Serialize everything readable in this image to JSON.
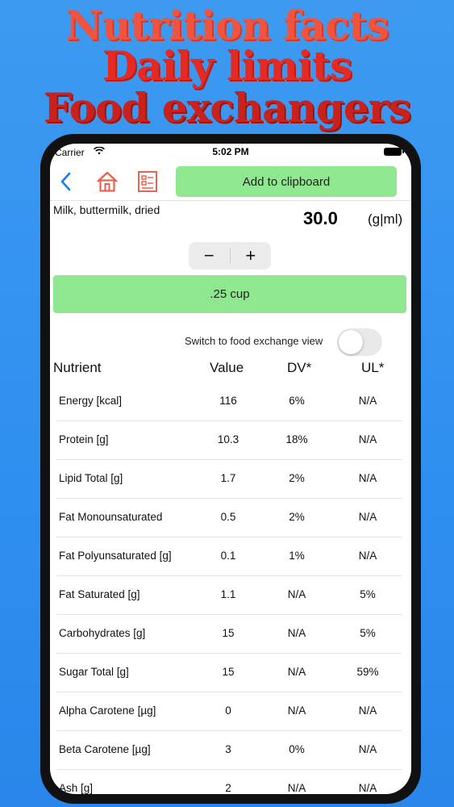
{
  "promo": {
    "line1": "Nutrition facts",
    "line2": "Daily limits",
    "line3": "Food exchangers"
  },
  "status": {
    "carrier": "Carrier",
    "time": "5:02 PM"
  },
  "toolbar": {
    "clipboard_label": "Add to clipboard"
  },
  "food": {
    "name": "Milk, buttermilk, dried",
    "amount": "30.0",
    "unit": "(g|ml)"
  },
  "stepper": {
    "minus": "−",
    "plus": "+"
  },
  "portion": {
    "label": ".25 cup"
  },
  "exchange_switch": {
    "label": "Switch to food exchange view",
    "on": false
  },
  "table": {
    "headers": {
      "nutrient": "Nutrient",
      "value": "Value",
      "dv": "DV*",
      "ul": "UL*"
    },
    "rows": [
      {
        "name": "Energy [kcal]",
        "value": "116",
        "dv": "6%",
        "ul": "N/A"
      },
      {
        "name": "Protein [g]",
        "value": "10.3",
        "dv": "18%",
        "ul": "N/A"
      },
      {
        "name": "Lipid Total [g]",
        "value": "1.7",
        "dv": "2%",
        "ul": "N/A"
      },
      {
        "name": "Fat Monounsaturated",
        "value": "0.5",
        "dv": "2%",
        "ul": "N/A"
      },
      {
        "name": "Fat Polyunsaturated [g]",
        "value": "0.1",
        "dv": "1%",
        "ul": "N/A"
      },
      {
        "name": "Fat Saturated [g]",
        "value": "1.1",
        "dv": "N/A",
        "ul": "5%"
      },
      {
        "name": "Carbohydrates [g]",
        "value": "15",
        "dv": "N/A",
        "ul": "5%"
      },
      {
        "name": "Sugar Total [g]",
        "value": "15",
        "dv": "N/A",
        "ul": "59%"
      },
      {
        "name": "Alpha Carotene [µg]",
        "value": "0",
        "dv": "N/A",
        "ul": "N/A"
      },
      {
        "name": "Beta Carotene [µg]",
        "value": "3",
        "dv": "0%",
        "ul": "N/A"
      },
      {
        "name": "Ash [g]",
        "value": "2",
        "dv": "N/A",
        "ul": "N/A"
      }
    ]
  },
  "icons": {
    "back": "chevron-left-icon",
    "home": "home-icon",
    "list": "list-icon",
    "wifi": "wifi-icon",
    "battery": "battery-icon"
  },
  "colors": {
    "accent_green": "#8fe88f",
    "icon_red": "#e8634f",
    "back_blue": "#1a7cf5",
    "background_blue": "#3d9af0"
  }
}
